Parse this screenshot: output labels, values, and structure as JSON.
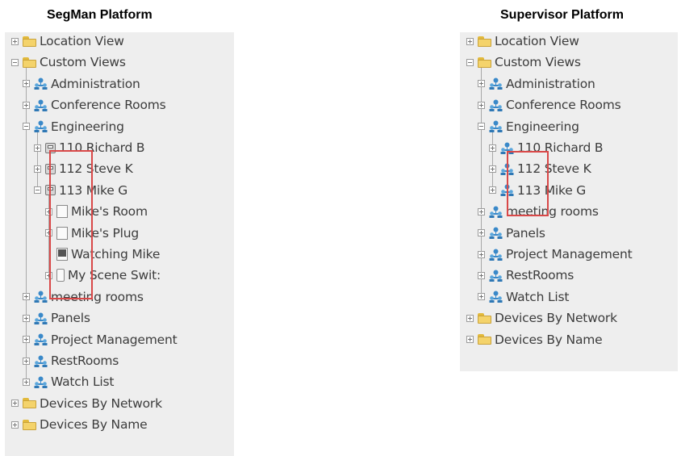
{
  "titles": {
    "left": "SegMan Platform",
    "right": "Supervisor Platform"
  },
  "colors": {
    "highlight": "#d94848",
    "panel_bg": "#eeeeee",
    "folder": "#f4d36b",
    "people_icon": "#3a89c9"
  },
  "left_tree": [
    {
      "label": "Location View",
      "icon": "folder-icon",
      "expander": "plus"
    },
    {
      "label": "Custom Views",
      "icon": "folder-icon",
      "expander": "minus"
    },
    {
      "label": "Administration",
      "icon": "people-icon",
      "expander": "plus"
    },
    {
      "label": "Conference Rooms",
      "icon": "people-icon",
      "expander": "plus"
    },
    {
      "label": "Engineering",
      "icon": "people-icon",
      "expander": "minus"
    },
    {
      "label": "110 Richard B",
      "icon": "device-icon",
      "expander": "plus"
    },
    {
      "label": "112 Steve K",
      "icon": "device-icon",
      "expander": "plus"
    },
    {
      "label": "113 Mike G",
      "icon": "device-icon",
      "expander": "minus"
    },
    {
      "label": "Mike's Room",
      "icon": "page-icon",
      "expander": "plus"
    },
    {
      "label": "Mike's Plug",
      "icon": "page-icon",
      "expander": "plus"
    },
    {
      "label": "Watching Mike",
      "icon": "monitor-icon",
      "expander": "none"
    },
    {
      "label": "My Scene Swit:",
      "icon": "switch-icon",
      "expander": "plus"
    },
    {
      "label": "meeting rooms",
      "icon": "people-icon",
      "expander": "plus"
    },
    {
      "label": "Panels",
      "icon": "people-icon",
      "expander": "plus"
    },
    {
      "label": "Project Management",
      "icon": "people-icon",
      "expander": "plus"
    },
    {
      "label": "RestRooms",
      "icon": "people-icon",
      "expander": "plus"
    },
    {
      "label": "Watch List",
      "icon": "people-icon",
      "expander": "plus"
    },
    {
      "label": "Devices By Network",
      "icon": "folder-icon",
      "expander": "plus"
    },
    {
      "label": "Devices By Name",
      "icon": "folder-icon",
      "expander": "plus"
    }
  ],
  "right_tree": [
    {
      "label": "Location View",
      "icon": "folder-icon",
      "expander": "plus"
    },
    {
      "label": "Custom Views",
      "icon": "folder-icon",
      "expander": "minus"
    },
    {
      "label": "Administration",
      "icon": "people-icon",
      "expander": "plus"
    },
    {
      "label": "Conference Rooms",
      "icon": "people-icon",
      "expander": "plus"
    },
    {
      "label": "Engineering",
      "icon": "people-icon",
      "expander": "minus"
    },
    {
      "label": "110 Richard B",
      "icon": "people-icon",
      "expander": "plus"
    },
    {
      "label": "112 Steve K",
      "icon": "people-icon",
      "expander": "plus"
    },
    {
      "label": "113 Mike G",
      "icon": "people-icon",
      "expander": "plus"
    },
    {
      "label": "meeting rooms",
      "icon": "people-icon",
      "expander": "plus"
    },
    {
      "label": "Panels",
      "icon": "people-icon",
      "expander": "plus"
    },
    {
      "label": "Project Management",
      "icon": "people-icon",
      "expander": "plus"
    },
    {
      "label": "RestRooms",
      "icon": "people-icon",
      "expander": "plus"
    },
    {
      "label": "Watch List",
      "icon": "people-icon",
      "expander": "plus"
    },
    {
      "label": "Devices By Network",
      "icon": "folder-icon",
      "expander": "plus"
    },
    {
      "label": "Devices By Name",
      "icon": "folder-icon",
      "expander": "plus"
    }
  ]
}
